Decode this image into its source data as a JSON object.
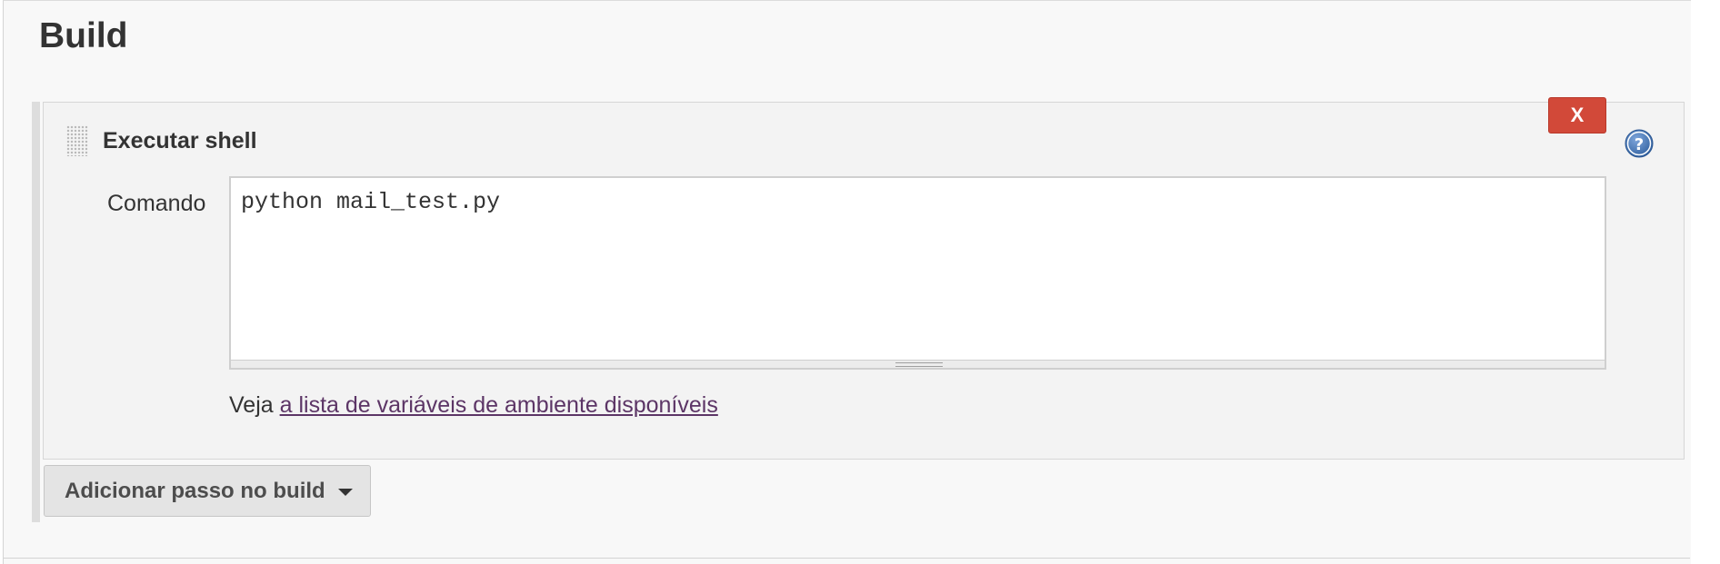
{
  "section": {
    "title": "Build"
  },
  "step": {
    "title": "Executar shell",
    "delete_label": "X",
    "help_icon": "question-circle-icon",
    "drag_icon": "drag-handle-icon",
    "field_label": "Comando",
    "command_value": "python mail_test.py",
    "help_prefix": "Veja ",
    "help_link": "a lista de variáveis de ambiente disponíveis"
  },
  "add_step": {
    "label": "Adicionar passo no build",
    "icon": "caret-down-icon"
  },
  "colors": {
    "delete_button": "#d24939",
    "link": "#5c3566",
    "help_icon": "#3d6fb0"
  }
}
